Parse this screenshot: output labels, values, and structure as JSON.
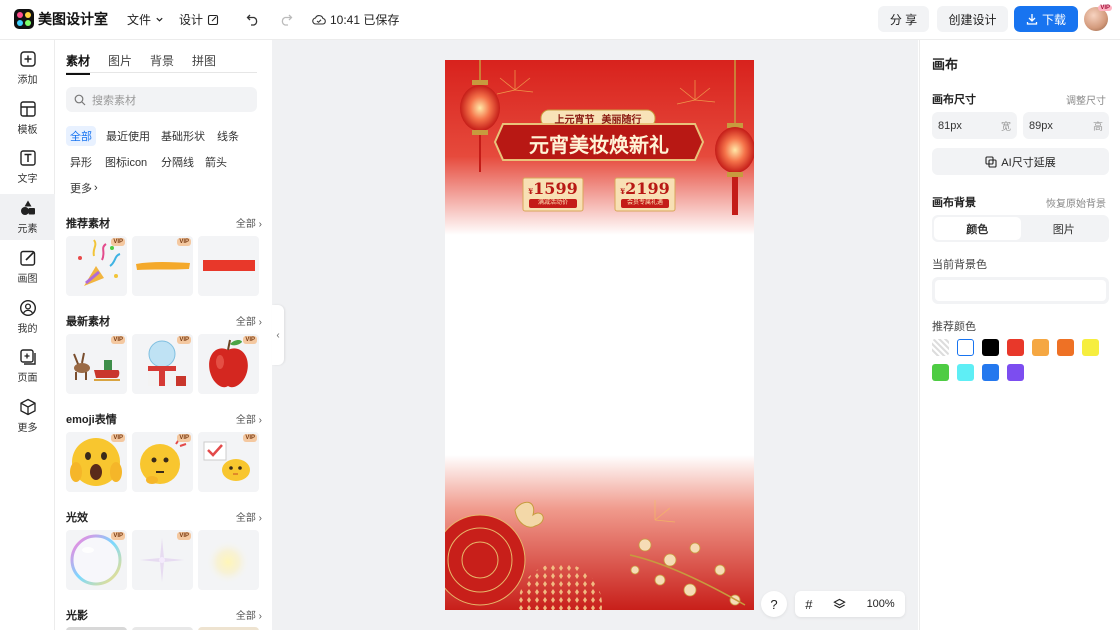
{
  "app": {
    "name": "美图设计室"
  },
  "topbar": {
    "file_label": "文件",
    "design_label": "设计",
    "save_status": "10:41 已保存",
    "share_label": "分 享",
    "create_label": "创建设计",
    "download_label": "下载"
  },
  "rail": {
    "items": [
      {
        "label": "添加",
        "icon": "plus-square-icon"
      },
      {
        "label": "模板",
        "icon": "template-icon"
      },
      {
        "label": "文字",
        "icon": "text-icon"
      },
      {
        "label": "元素",
        "icon": "shapes-icon"
      },
      {
        "label": "画图",
        "icon": "draw-icon"
      },
      {
        "label": "我的",
        "icon": "user-icon"
      },
      {
        "label": "页面",
        "icon": "page-icon"
      },
      {
        "label": "更多",
        "icon": "cube-icon"
      }
    ]
  },
  "panel": {
    "tabs": [
      "素材",
      "图片",
      "背景",
      "拼图"
    ],
    "search_placeholder": "搜索素材",
    "chips": [
      "全部",
      "最近使用",
      "基础形状",
      "线条",
      "异形",
      "图标icon",
      "分隔线",
      "箭头",
      "更多"
    ],
    "all_label": "全部",
    "sections": [
      {
        "title": "推荐素材"
      },
      {
        "title": "最新素材"
      },
      {
        "title": "emoji表情"
      },
      {
        "title": "光效"
      },
      {
        "title": "光影"
      }
    ],
    "vip_label": "VIP"
  },
  "poster": {
    "tag_text": "上元宵节  美丽随行",
    "headline": "元宵美妆焕新礼",
    "coupon1_value": "1599",
    "coupon1_label": "满减活动价",
    "coupon2_value": "2199",
    "coupon2_label": "会员专属礼遇",
    "currency": "¥"
  },
  "floating": {
    "help": "?",
    "zoom": "100%"
  },
  "right_panel": {
    "title": "画布",
    "size_label": "画布尺寸",
    "adjust_size": "调整尺寸",
    "width_value": "81px",
    "width_unit": "宽",
    "height_value": "89px",
    "height_unit": "高",
    "ai_extend": "AI尺寸延展",
    "bg_label": "画布背景",
    "reset_bg": "恢复原始背景",
    "seg_color": "颜色",
    "seg_image": "图片",
    "current_bg": "当前背景色",
    "recommended": "推荐颜色",
    "swatches": [
      "transparent",
      "#ffffff",
      "#000000",
      "#e8382a",
      "#f5a742",
      "#ee7125",
      "#f6ee3f",
      "#4ecc43",
      "#5eeef5",
      "#2478ee",
      "#7c4df0"
    ]
  }
}
